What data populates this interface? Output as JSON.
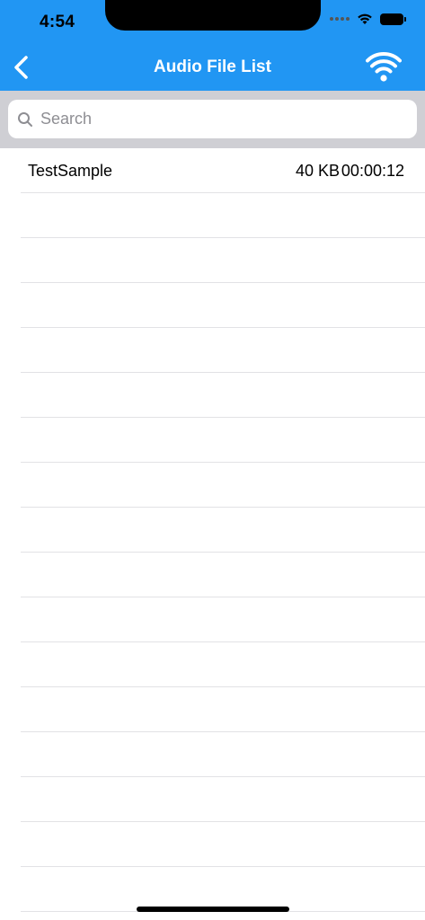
{
  "status_bar": {
    "time": "4:54"
  },
  "nav": {
    "title": "Audio File List",
    "back_icon": "chevron-left-icon",
    "right_icon": "wifi-icon"
  },
  "search": {
    "placeholder": "Search",
    "value": ""
  },
  "files": [
    {
      "name": "TestSample",
      "size": "40 KB",
      "duration": "00:00:12"
    }
  ],
  "colors": {
    "nav_background": "#2196F3",
    "search_area_background": "#cfcfd4",
    "separator": "#e2e2e5"
  }
}
